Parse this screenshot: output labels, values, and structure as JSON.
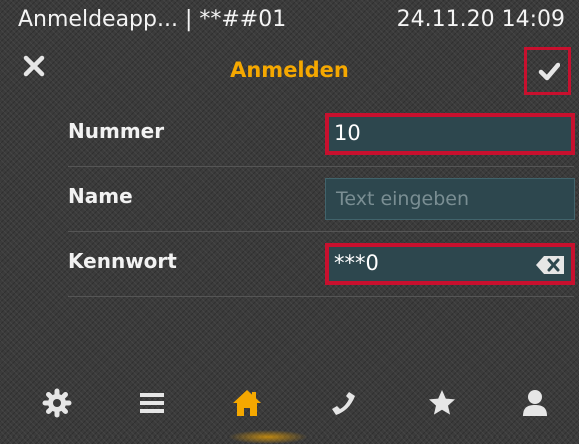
{
  "status_bar": {
    "app_title": "Anmeldeapp... | **##01",
    "datetime": "24.11.20  14:09"
  },
  "header": {
    "title": "Anmelden",
    "cancel_icon": "close-icon",
    "confirm_icon": "checkmark-icon"
  },
  "form": {
    "fields": [
      {
        "label": "Nummer",
        "value": "10",
        "placeholder": ""
      },
      {
        "label": "Name",
        "value": "",
        "placeholder": "Text eingeben"
      },
      {
        "label": "Kennwort",
        "value": "***0",
        "placeholder": ""
      }
    ]
  },
  "nav": {
    "items": [
      "settings-icon",
      "menu-icon",
      "home-icon",
      "phone-icon",
      "favorites-icon",
      "contacts-icon"
    ],
    "active": "home-icon"
  },
  "colors": {
    "accent": "#f5a800",
    "highlight_border": "#c8102e",
    "field_bg": "#2d474e",
    "icon": "#e6e6e6"
  }
}
